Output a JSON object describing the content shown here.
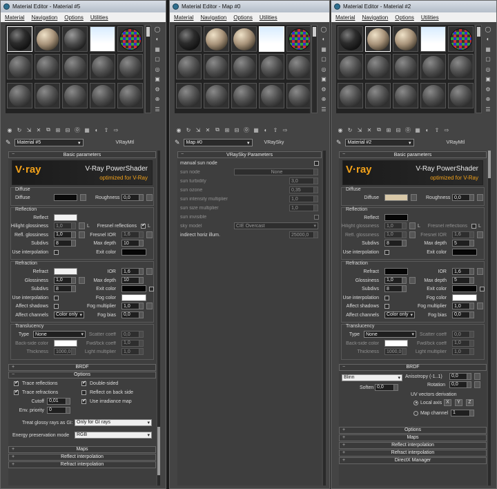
{
  "menu": [
    "Material",
    "Navigation",
    "Options",
    "Utilities"
  ],
  "windows": [
    {
      "title": "Material Editor - Material #5",
      "name": "Material #5",
      "type": "VRayMtl"
    },
    {
      "title": "Material Editor - Map #0",
      "name": "Map #0",
      "type": "VRaySky"
    },
    {
      "title": "Material Editor - Material #2",
      "name": "Material #2",
      "type": "VRayMtl"
    }
  ],
  "rollouts": {
    "basic": "Basic parameters",
    "brdf": "BRDF",
    "options": "Options",
    "maps": "Maps",
    "reflect_interp": "Reflect interpolation",
    "refract_interp": "Refract interpolation",
    "directx": "DirectX Manager",
    "vraysky": "VRaySky Parameters"
  },
  "banner": {
    "logo": "V·ray",
    "line1": "V-Ray PowerShader",
    "line2": "optimized for V-Ray"
  },
  "diffuse": {
    "group": "Diffuse",
    "label": "Diffuse",
    "roughness_label": "Roughness",
    "roughness": "0,0"
  },
  "reflection": {
    "group": "Reflection",
    "reflect": "Reflect",
    "hilight": "Hilight glossiness",
    "refl_gloss": "Refl. glossiness",
    "subdivs": "Subdivs",
    "use_interp": "Use interpolation",
    "fresnel": "Fresnel reflections",
    "fresnel_ior": "Fresnel IOR",
    "max_depth": "Max depth",
    "exit_color": "Exit color",
    "L": "L",
    "gloss_val": "1,0",
    "subdivs_val": "8",
    "fresnel_ior_val": "1,6",
    "max_depth_a": "10",
    "max_depth_b": "5"
  },
  "refraction": {
    "group": "Refraction",
    "refract": "Refract",
    "glossiness": "Glossiness",
    "subdivs": "Subdivs",
    "use_interp": "Use interpolation",
    "affect_shadows": "Affect shadows",
    "affect_channels": "Affect channels",
    "ior": "IOR",
    "max_depth": "Max depth",
    "exit_color": "Exit color",
    "fog_color": "Fog color",
    "fog_mult": "Fog multiplier",
    "fog_bias": "Fog bias",
    "ior_val": "1,6",
    "gloss_val": "1,0",
    "subdivs_val": "8",
    "max_depth_val": "5",
    "max_depth_a": "10",
    "fog_mult_val": "1,0",
    "fog_bias_val": "0,0",
    "channels_val": "Color only"
  },
  "translucency": {
    "group": "Translucency",
    "type": "Type",
    "type_val": "None",
    "backside": "Back-side color",
    "thickness": "Thickness",
    "thickness_val": "1000,0",
    "scatter": "Scatter coeff",
    "fwdbck": "Fwd/bck coeff",
    "light_mult": "Light multiplier",
    "scatter_val": "0,0",
    "fwdbck_val": "1,0",
    "light_mult_val": "1,0"
  },
  "options": {
    "trace_refl": "Trace reflections",
    "trace_refr": "Trace refractions",
    "cutoff": "Cutoff",
    "cutoff_val": "0,01",
    "env_priority": "Env. priority",
    "env_val": "0",
    "double_sided": "Double-sided",
    "reflect_back": "Reflect on back side",
    "use_irr": "Use irradiance map",
    "glossy_label": "Treat glossy rays as GI:",
    "glossy_val": "Only for GI rays",
    "energy_label": "Energy preservation mode",
    "energy_val": "RGB"
  },
  "brdf": {
    "type": "Blinn",
    "soften": "Soften",
    "soften_val": "0,0",
    "aniso": "Anisotropy (-1..1)",
    "aniso_val": "0,0",
    "rotation": "Rotation",
    "rotation_val": "0,0",
    "uv_label": "UV vectors derivation",
    "local_axis": "Local axis",
    "map_channel": "Map channel",
    "map_channel_val": "1",
    "x": "X",
    "y": "Y",
    "z": "Z"
  },
  "sky": {
    "manual": "manual sun node",
    "sun_node": "sun node",
    "sun_node_val": "None",
    "turbidity": "sun turbidity",
    "turbidity_val": "3,0",
    "ozone": "sun ozone",
    "ozone_val": "0,35",
    "intensity": "sun intensity multiplier",
    "intensity_val": "1,0",
    "size": "sun size multiplier",
    "size_val": "1,0",
    "invisible": "sun invisible",
    "model": "sky model",
    "model_val": "CIE Overcast",
    "horiz": "indirect horiz illum.",
    "horiz_val": "25000,0"
  },
  "colors": {
    "diffuse_a": "#0a0a0a",
    "diffuse_b": "#d8c8a8",
    "reflect_a": "#f2f2f2",
    "reflect_b": "#050505",
    "exit": "#050505",
    "refract_a": "#f2f2f2",
    "refract_b": "#050505",
    "fog": "#ffffff",
    "backside": "#ffffff"
  }
}
